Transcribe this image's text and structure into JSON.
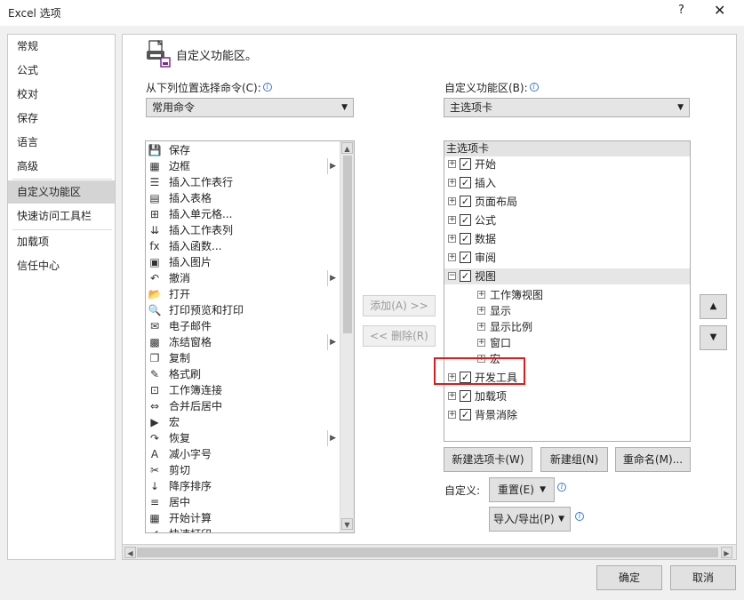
{
  "window": {
    "title": "Excel 选项",
    "help": "?",
    "close": "✕"
  },
  "nav": {
    "items": [
      {
        "label": "常规"
      },
      {
        "label": "公式"
      },
      {
        "label": "校对"
      },
      {
        "label": "保存"
      },
      {
        "label": "语言"
      },
      {
        "label": "高级"
      },
      {
        "label": "自定义功能区"
      },
      {
        "label": "快速访问工具栏"
      },
      {
        "label": "加载项"
      },
      {
        "label": "信任中心"
      }
    ],
    "selected": "自定义功能区"
  },
  "header": {
    "title": "自定义功能区。"
  },
  "left": {
    "label": "从下列位置选择命令(C):",
    "combo_value": "常用命令",
    "commands": [
      {
        "label": "保存",
        "icon": "💾",
        "sub": false
      },
      {
        "label": "边框",
        "icon": "▦",
        "sub": true
      },
      {
        "label": "插入工作表行",
        "icon": "☰",
        "sub": false
      },
      {
        "label": "插入表格",
        "icon": "▤",
        "sub": false
      },
      {
        "label": "插入单元格...",
        "icon": "⊞",
        "sub": false
      },
      {
        "label": "插入工作表列",
        "icon": "⇊",
        "sub": false
      },
      {
        "label": "插入函数...",
        "icon": "fx",
        "sub": false
      },
      {
        "label": "插入图片",
        "icon": "▣",
        "sub": false
      },
      {
        "label": "撤消",
        "icon": "↶",
        "sub": true
      },
      {
        "label": "打开",
        "icon": "📂",
        "sub": false
      },
      {
        "label": "打印预览和打印",
        "icon": "🔍",
        "sub": false
      },
      {
        "label": "电子邮件",
        "icon": "✉",
        "sub": false
      },
      {
        "label": "冻结窗格",
        "icon": "▩",
        "sub": true
      },
      {
        "label": "复制",
        "icon": "❐",
        "sub": false
      },
      {
        "label": "格式刷",
        "icon": "✎",
        "sub": false
      },
      {
        "label": "工作簿连接",
        "icon": "⊡",
        "sub": false
      },
      {
        "label": "合并后居中",
        "icon": "⇔",
        "sub": false
      },
      {
        "label": "宏",
        "icon": "▶",
        "sub": false
      },
      {
        "label": "恢复",
        "icon": "↷",
        "sub": true
      },
      {
        "label": "减小字号",
        "icon": "A",
        "sub": false
      },
      {
        "label": "剪切",
        "icon": "✂",
        "sub": false
      },
      {
        "label": "降序排序",
        "icon": "↓",
        "sub": false
      },
      {
        "label": "居中",
        "icon": "≡",
        "sub": false
      },
      {
        "label": "开始计算",
        "icon": "▦",
        "sub": false
      },
      {
        "label": "快速打印",
        "icon": "✔",
        "sub": false
      }
    ]
  },
  "middle": {
    "add": "添加(A) >>",
    "remove": "<< 删除(R)"
  },
  "right": {
    "label": "自定义功能区(B):",
    "combo_value": "主选项卡",
    "tree_header": "主选项卡",
    "tabs_top": [
      {
        "label": "开始",
        "checked": true
      },
      {
        "label": "插入",
        "checked": true
      },
      {
        "label": "页面布局",
        "checked": true
      },
      {
        "label": "公式",
        "checked": true
      },
      {
        "label": "数据",
        "checked": true
      },
      {
        "label": "审阅",
        "checked": true
      }
    ],
    "view_tab": {
      "label": "视图",
      "checked": true,
      "groups": [
        "工作簿视图",
        "显示",
        "显示比例",
        "窗口",
        "宏"
      ]
    },
    "tabs_bottom": [
      {
        "label": "开发工具",
        "checked": true
      },
      {
        "label": "加载项",
        "checked": true
      },
      {
        "label": "背景消除",
        "checked": true
      }
    ],
    "buttons": {
      "new_tab": "新建选项卡(W)",
      "new_group": "新建组(N)",
      "rename": "重命名(M)..."
    },
    "customize_label": "自定义:",
    "reset": "重置(E)",
    "import_export": "导入/导出(P)",
    "move_up": "▲",
    "move_down": "▼"
  },
  "footer": {
    "ok": "确定",
    "cancel": "取消"
  },
  "colors": {
    "highlight": "#e01b1b",
    "selected_nav": "#d4d4d4"
  }
}
